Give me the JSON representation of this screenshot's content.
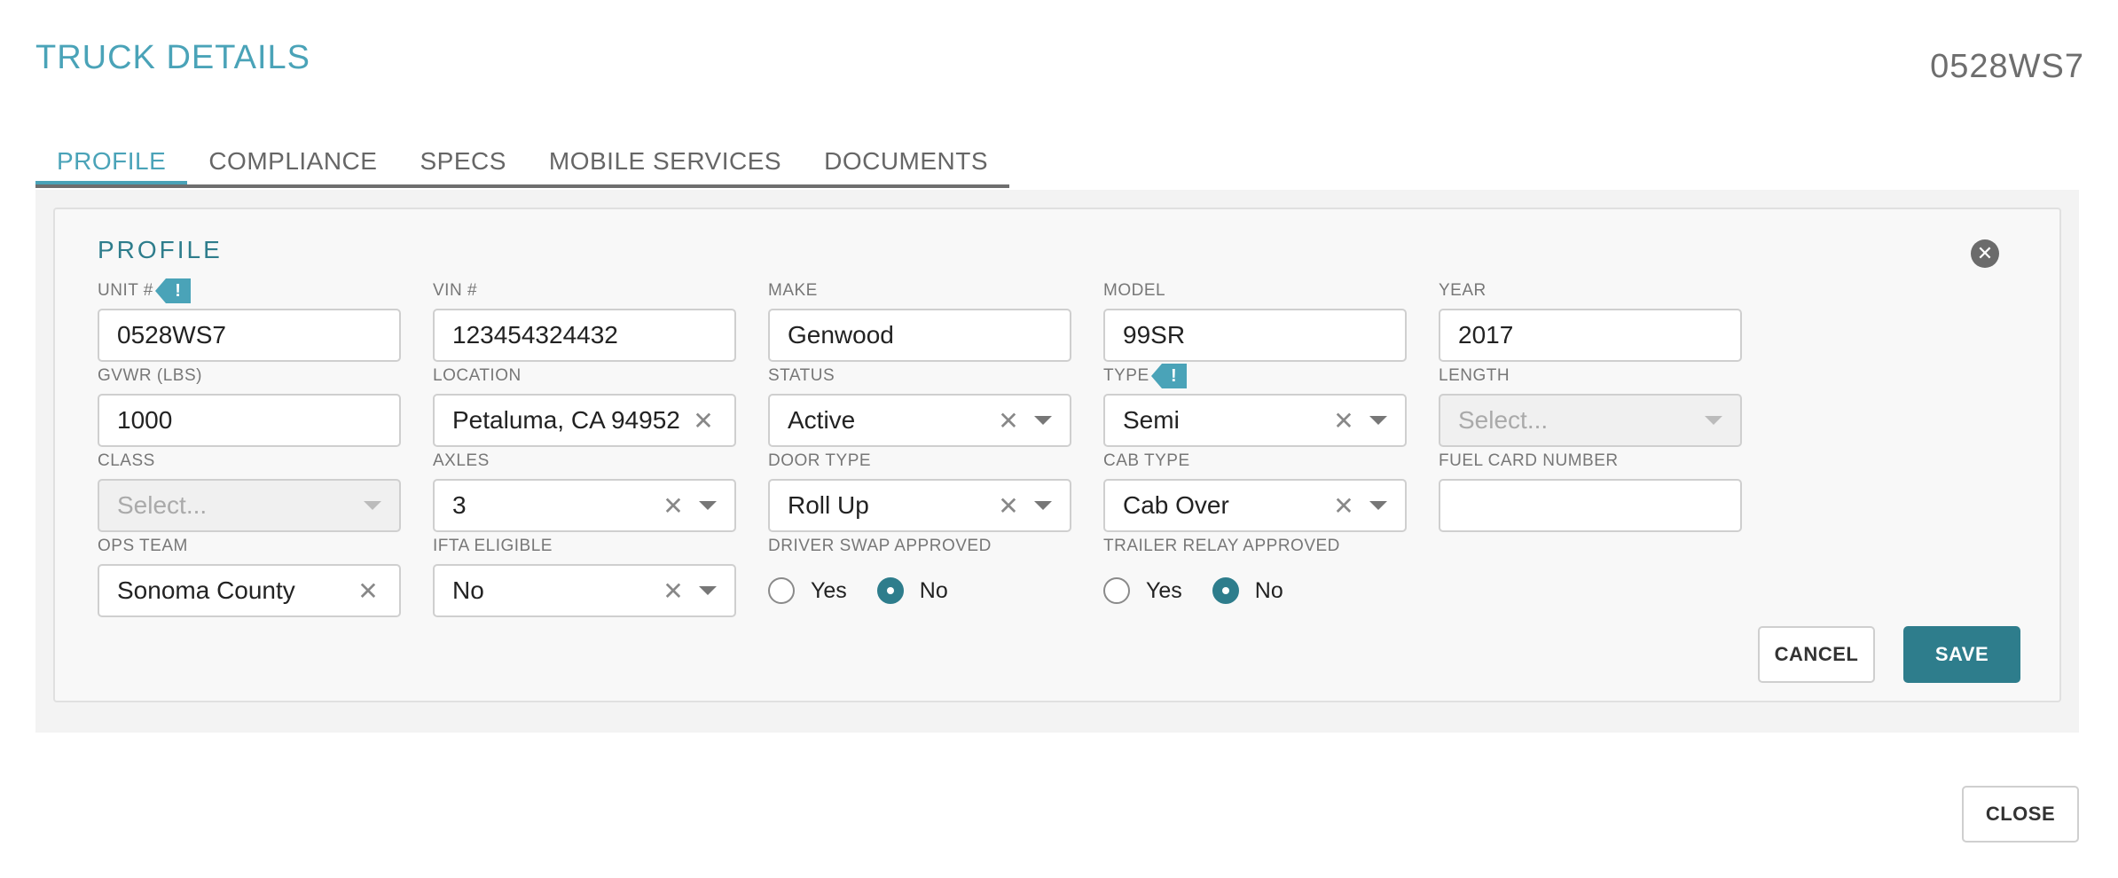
{
  "header": {
    "title": "TRUCK DETAILS",
    "truck_id": "0528WS7"
  },
  "tabs": [
    {
      "label": "PROFILE",
      "active": true
    },
    {
      "label": "COMPLIANCE",
      "active": false
    },
    {
      "label": "SPECS",
      "active": false
    },
    {
      "label": "MOBILE SERVICES",
      "active": false
    },
    {
      "label": "DOCUMENTS",
      "active": false
    }
  ],
  "profile": {
    "section_title": "PROFILE",
    "fields": {
      "unit": {
        "label": "UNIT #",
        "value": "0528WS7"
      },
      "vin": {
        "label": "VIN #",
        "value": "123454324432"
      },
      "make": {
        "label": "MAKE",
        "value": "Genwood"
      },
      "model": {
        "label": "MODEL",
        "value": "99SR"
      },
      "year": {
        "label": "YEAR",
        "value": "2017"
      },
      "gvwr": {
        "label": "GVWR (LBS)",
        "value": "1000"
      },
      "location": {
        "label": "LOCATION",
        "value": "Petaluma, CA 94952"
      },
      "status": {
        "label": "STATUS",
        "value": "Active"
      },
      "type": {
        "label": "TYPE",
        "value": "Semi"
      },
      "length": {
        "label": "LENGTH",
        "placeholder": "Select..."
      },
      "class": {
        "label": "CLASS",
        "placeholder": "Select..."
      },
      "axles": {
        "label": "AXLES",
        "value": "3"
      },
      "door_type": {
        "label": "DOOR TYPE",
        "value": "Roll Up"
      },
      "cab_type": {
        "label": "CAB TYPE",
        "value": "Cab Over"
      },
      "fuel_card": {
        "label": "FUEL CARD NUMBER",
        "value": ""
      },
      "ops_team": {
        "label": "OPS TEAM",
        "value": "Sonoma County"
      },
      "ifta": {
        "label": "IFTA ELIGIBLE",
        "value": "No"
      },
      "driver_swap": {
        "label": "DRIVER SWAP APPROVED",
        "yes": "Yes",
        "no": "No",
        "selected": "No"
      },
      "trailer_relay": {
        "label": "TRAILER RELAY APPROVED",
        "yes": "Yes",
        "no": "No",
        "selected": "No"
      }
    },
    "flag_glyph": "!",
    "clear_glyph": "✕",
    "close_glyph": "✕"
  },
  "buttons": {
    "cancel": "CANCEL",
    "save": "SAVE",
    "close": "CLOSE"
  }
}
